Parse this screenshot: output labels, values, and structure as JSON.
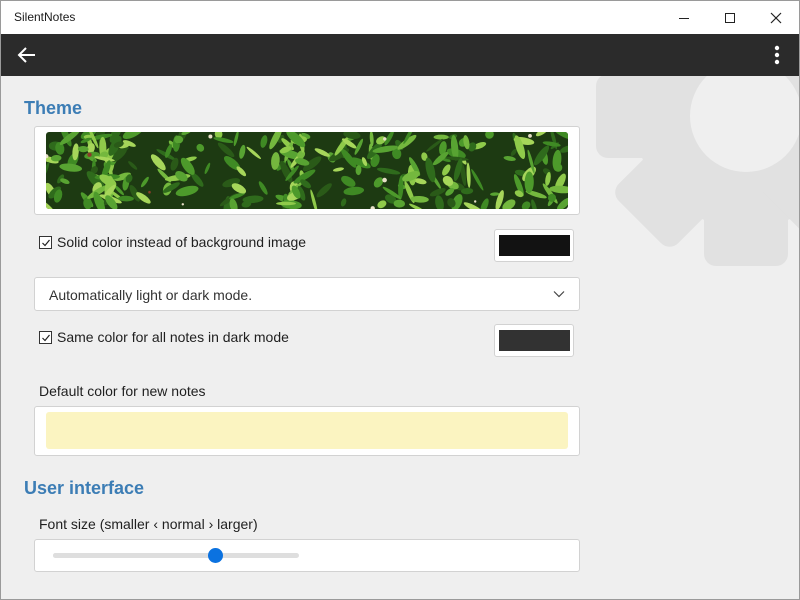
{
  "window": {
    "title": "SilentNotes",
    "minimize_icon": "minimize-icon",
    "maximize_icon": "maximize-icon",
    "close_icon": "close-icon"
  },
  "appbar": {
    "back_icon": "arrow-left-icon",
    "more_icon": "more-vertical-icon",
    "background": "#2b2b2b"
  },
  "theme": {
    "section_title": "Theme",
    "background_image": "jungle-leaves-image",
    "solid_color": {
      "label": "Solid color instead of background image",
      "checked": true,
      "color": "#121212"
    },
    "mode_dropdown": {
      "selected": "Automatically light or dark mode."
    },
    "dark_mode_same_color": {
      "label": "Same color for all notes in dark mode",
      "checked": true,
      "color": "#323232"
    },
    "default_note_color": {
      "label": "Default color for new notes",
      "color": "#fbf4c1"
    }
  },
  "user_interface": {
    "section_title": "User interface",
    "font_size": {
      "label": "Font size (smaller ‹ normal › larger)",
      "value": 0.66
    }
  },
  "colors": {
    "accent": "#3c7db5",
    "slider_thumb": "#0b72e0"
  }
}
